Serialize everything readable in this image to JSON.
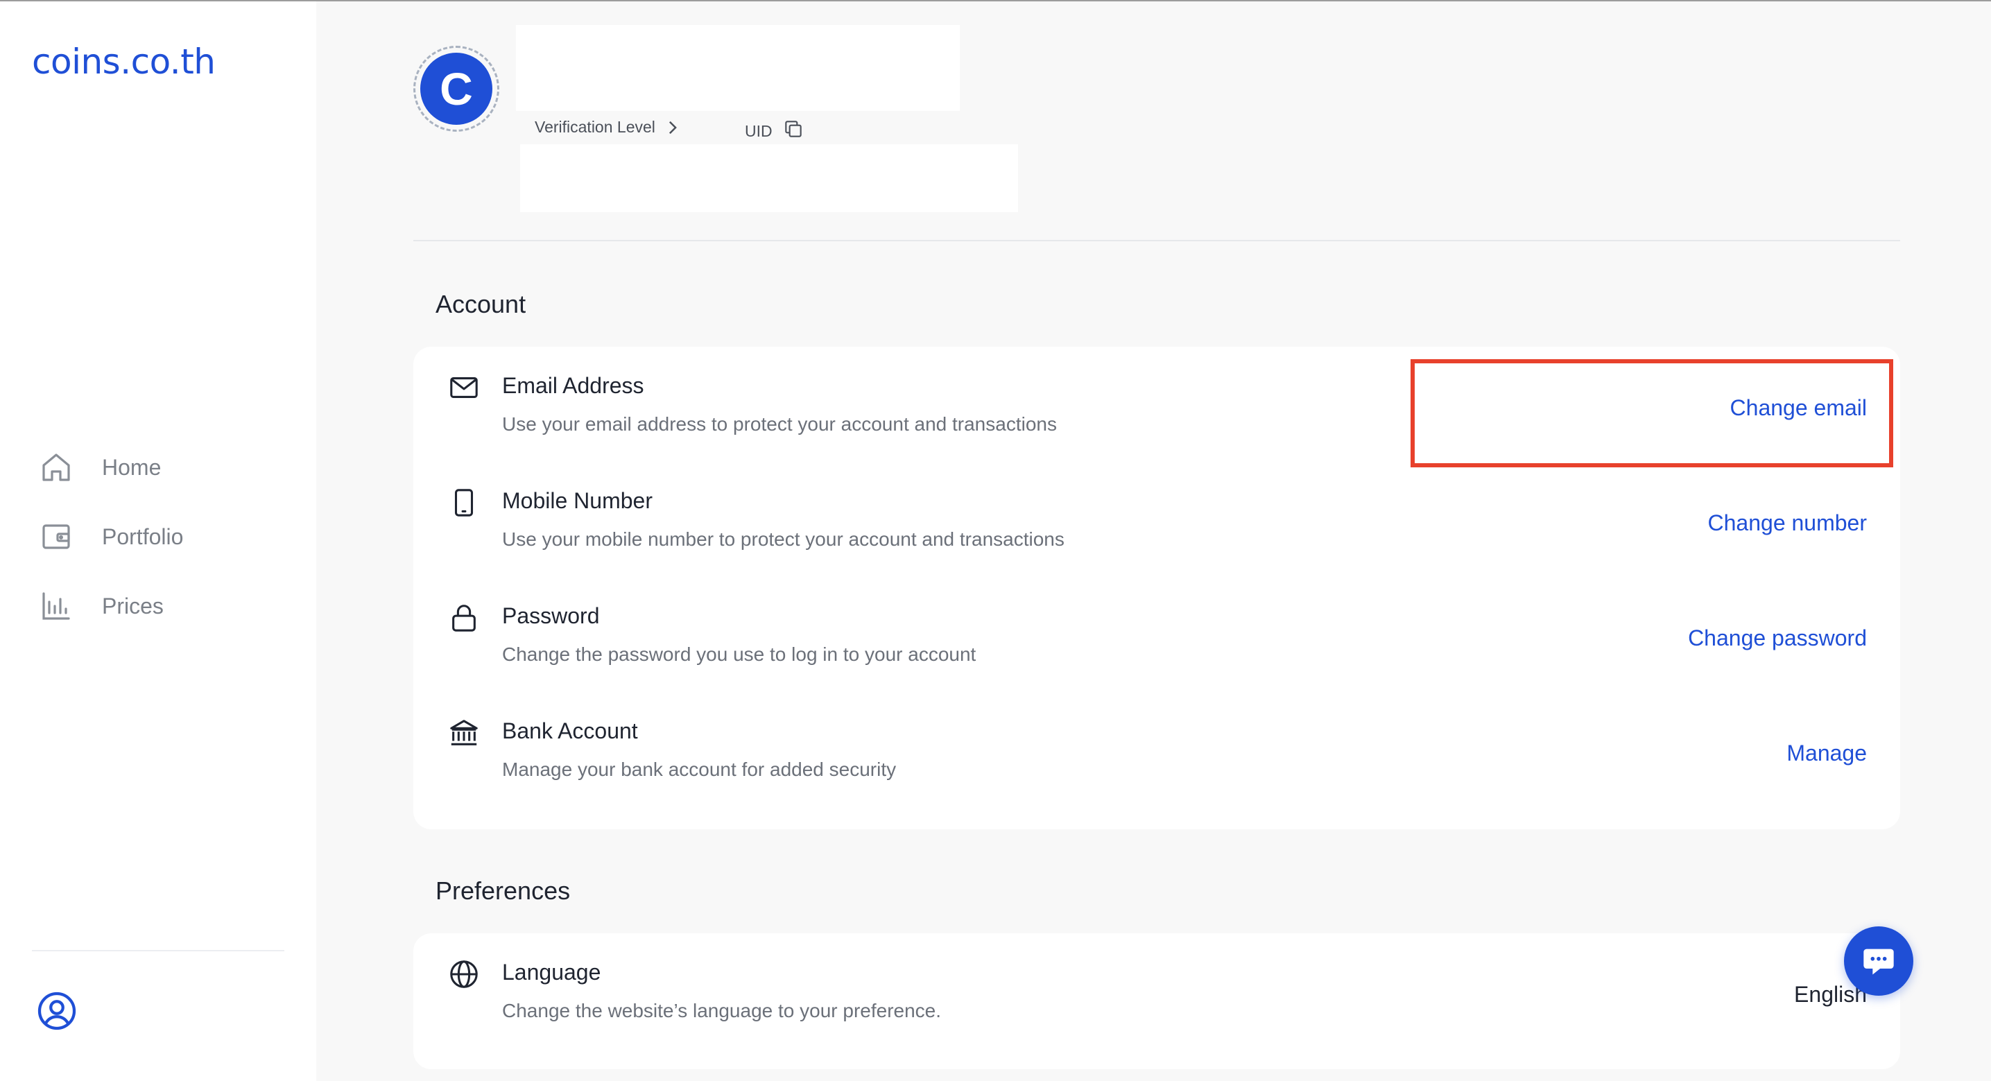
{
  "brand": {
    "logo_text": "coins.co.th",
    "accent_color": "#1f4fd6",
    "highlight_color": "#e8412c"
  },
  "sidebar": {
    "items": [
      {
        "label": "Home",
        "icon": "home-icon"
      },
      {
        "label": "Portfolio",
        "icon": "wallet-icon"
      },
      {
        "label": "Prices",
        "icon": "bar-chart-icon"
      }
    ],
    "profile_icon": "user-circle-icon"
  },
  "header": {
    "avatar_letter": "C",
    "verification_label": "Verification Level",
    "uid_label": "UID"
  },
  "account": {
    "title": "Account",
    "rows": [
      {
        "title": "Email Address",
        "description": "Use your email address to protect your account and transactions",
        "action": "Change email",
        "icon": "mail-icon"
      },
      {
        "title": "Mobile Number",
        "description": "Use your mobile number to protect your account and transactions",
        "action": "Change number",
        "icon": "phone-icon"
      },
      {
        "title": "Password",
        "description": "Change the password you use to log in to your account",
        "action": "Change password",
        "icon": "lock-icon"
      },
      {
        "title": "Bank Account",
        "description": "Manage your bank account for added security",
        "action": "Manage",
        "icon": "bank-icon"
      }
    ]
  },
  "preferences": {
    "title": "Preferences",
    "rows": [
      {
        "title": "Language",
        "description": "Change the website’s language to your preference.",
        "value": "English",
        "icon": "globe-icon"
      }
    ]
  },
  "chat": {
    "icon": "chat-bubble-icon"
  }
}
